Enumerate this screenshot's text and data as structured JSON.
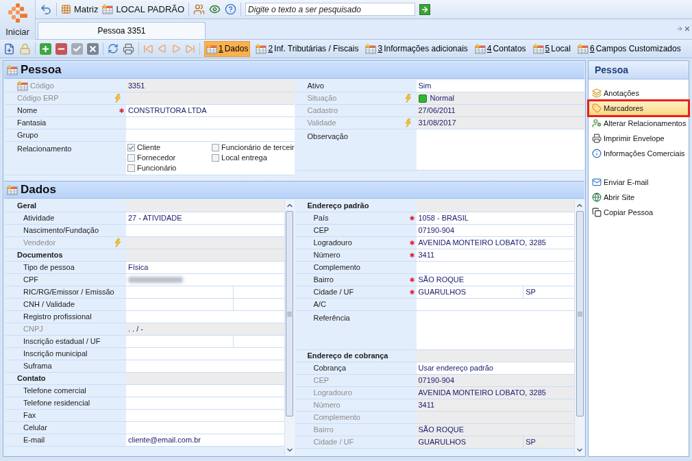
{
  "start_button": {
    "label": "Iniciar"
  },
  "top_toolbar": {
    "items": [
      {
        "label": "Matriz"
      },
      {
        "label": "LOCAL PADRÃO"
      }
    ],
    "search": {
      "placeholder": "Digite o texto a ser pesquisado"
    }
  },
  "document_tabs": [
    {
      "label": "Pessoa 3351",
      "selected": true
    }
  ],
  "record_tabs": [
    {
      "mnemonic": "1",
      "label": "Dados",
      "selected": true
    },
    {
      "mnemonic": "2",
      "label": "Inf. Tributárias / Fiscais",
      "selected": false
    },
    {
      "mnemonic": "3",
      "label": "Informações adicionais",
      "selected": false
    },
    {
      "mnemonic": "4",
      "label": "Contatos",
      "selected": false
    },
    {
      "mnemonic": "5",
      "label": "Local",
      "selected": false
    },
    {
      "mnemonic": "6",
      "label": "Campos Customizados",
      "selected": false
    }
  ],
  "pessoa": {
    "title": "Pessoa",
    "left_rows": [
      {
        "kind": "field",
        "label": "Código",
        "value": "3351",
        "has_icon": true,
        "disabled": true,
        "required": false,
        "lightning": false
      },
      {
        "kind": "field",
        "label": "Código ERP",
        "has_icon": false,
        "disabled": true,
        "required": false,
        "lightning": true
      },
      {
        "kind": "field",
        "label": "Nome",
        "value": "CONSTRUTORA LTDA",
        "has_icon": false,
        "disabled": false,
        "required": true,
        "lightning": false
      },
      {
        "kind": "field",
        "label": "Fantasia",
        "has_icon": false,
        "disabled": false,
        "required": false,
        "lightning": false
      },
      {
        "kind": "field",
        "label": "Grupo",
        "has_icon": false,
        "disabled": false,
        "required": false,
        "lightning": false
      },
      {
        "kind": "checkboxes",
        "label": "Relacionamento",
        "has_icon": false,
        "disabled": false,
        "required": false,
        "lightning": false,
        "options": [
          {
            "label": "Cliente",
            "checked": true
          },
          {
            "label": "Funcionário de terceir",
            "checked": false
          },
          {
            "label": "Fornecedor",
            "checked": false
          },
          {
            "label": "Local entrega",
            "checked": false
          },
          {
            "label": "Funcionário",
            "checked": false
          }
        ]
      }
    ],
    "right_rows": [
      {
        "kind": "field",
        "label": "Ativo",
        "value": "Sim",
        "has_icon": false,
        "disabled": false,
        "required": false,
        "lightning": false
      },
      {
        "kind": "status",
        "label": "Situação",
        "value": "Normal",
        "has_icon": false,
        "disabled": true,
        "required": false,
        "lightning": true
      },
      {
        "kind": "field",
        "label": "Cadastro",
        "value": "27/06/2011",
        "has_icon": false,
        "disabled": true,
        "required": false,
        "lightning": false
      },
      {
        "kind": "field",
        "label": "Validade",
        "value": "31/08/2017",
        "has_icon": false,
        "disabled": true,
        "required": false,
        "lightning": true
      },
      {
        "kind": "memo",
        "label": "Observação",
        "has_icon": false,
        "disabled": false,
        "required": false,
        "lightning": false
      }
    ]
  },
  "dados": {
    "title": "Dados",
    "left_rows": [
      {
        "kind": "header",
        "label": "Geral"
      },
      {
        "kind": "field",
        "label": "Atividade",
        "value": "27 - ATIVIDADE",
        "disabled": false,
        "required": false,
        "lightning": false
      },
      {
        "kind": "field",
        "label": "Nascimento/Fundação",
        "disabled": false,
        "required": false,
        "lightning": false
      },
      {
        "kind": "field",
        "label": "Vendedor",
        "disabled": true,
        "required": false,
        "lightning": true
      },
      {
        "kind": "header",
        "label": "Documentos"
      },
      {
        "kind": "field",
        "label": "Tipo de pessoa",
        "value": "Física",
        "disabled": false,
        "required": false,
        "lightning": false
      },
      {
        "kind": "redacted",
        "label": "CPF",
        "disabled": false,
        "required": false,
        "lightning": false
      },
      {
        "kind": "split",
        "label": "RIC/RG/Emissor / Emissão",
        "disabled": false,
        "required": false,
        "lightning": false
      },
      {
        "kind": "split",
        "label": "CNH / Validade",
        "disabled": false,
        "required": false,
        "lightning": false
      },
      {
        "kind": "field",
        "label": "Registro profissional",
        "disabled": false,
        "required": false,
        "lightning": false
      },
      {
        "kind": "field",
        "label": "CNPJ",
        "value": "  .   .   /    -",
        "disabled": true,
        "required": false,
        "lightning": false
      },
      {
        "kind": "split",
        "label": "Inscrição estadual / UF",
        "disabled": false,
        "required": false,
        "lightning": false
      },
      {
        "kind": "field",
        "label": "Inscrição municipal",
        "disabled": false,
        "required": false,
        "lightning": false
      },
      {
        "kind": "field",
        "label": "Suframa",
        "disabled": false,
        "required": false,
        "lightning": false
      },
      {
        "kind": "header",
        "label": "Contato"
      },
      {
        "kind": "field",
        "label": "Telefone comercial",
        "disabled": false,
        "required": false,
        "lightning": false
      },
      {
        "kind": "field",
        "label": "Telefone residencial",
        "disabled": false,
        "required": false,
        "lightning": false
      },
      {
        "kind": "field",
        "label": "Fax",
        "disabled": false,
        "required": false,
        "lightning": false
      },
      {
        "kind": "field",
        "label": "Celular",
        "disabled": false,
        "required": false,
        "lightning": false
      },
      {
        "kind": "field",
        "label": "E-mail",
        "value": "cliente@email.com.br",
        "disabled": false,
        "required": false,
        "lightning": false
      }
    ],
    "right_rows": [
      {
        "kind": "header",
        "label": "Endereço padrão"
      },
      {
        "kind": "field",
        "label": "País",
        "value": "1058 - BRASIL",
        "disabled": false,
        "required": true,
        "lightning": false
      },
      {
        "kind": "field",
        "label": "CEP",
        "value": "07190-904",
        "disabled": false,
        "required": false,
        "lightning": false
      },
      {
        "kind": "field",
        "label": "Logradouro",
        "value": "AVENIDA MONTEIRO LOBATO, 3285",
        "disabled": false,
        "required": true,
        "lightning": false
      },
      {
        "kind": "field",
        "label": "Número",
        "value": "3411",
        "disabled": false,
        "required": true,
        "lightning": false
      },
      {
        "kind": "field",
        "label": "Complemento",
        "disabled": false,
        "required": false,
        "lightning": false
      },
      {
        "kind": "field",
        "label": "Bairro",
        "value": "SÃO ROQUE",
        "disabled": false,
        "required": true,
        "lightning": false
      },
      {
        "kind": "split",
        "label": "Cidade / UF",
        "value": "GUARULHOS",
        "value_2": "SP",
        "disabled": false,
        "required": true,
        "lightning": false
      },
      {
        "kind": "field",
        "label": "A/C",
        "disabled": false,
        "required": false,
        "lightning": false
      },
      {
        "kind": "memo",
        "label": "Referência",
        "disabled": false,
        "required": false,
        "lightning": false
      },
      {
        "kind": "header",
        "label": "Endereço de cobrança"
      },
      {
        "kind": "field",
        "label": "Cobrança",
        "value": "Usar endereço padrão",
        "disabled": false,
        "required": false,
        "lightning": false
      },
      {
        "kind": "field",
        "label": "CEP",
        "value": "07190-904",
        "disabled": true,
        "required": false,
        "lightning": false
      },
      {
        "kind": "field",
        "label": "Logradouro",
        "value": "AVENIDA MONTEIRO LOBATO, 3285",
        "disabled": true,
        "required": false,
        "lightning": false
      },
      {
        "kind": "field",
        "label": "Número",
        "value": "3411",
        "disabled": true,
        "required": false,
        "lightning": false
      },
      {
        "kind": "field",
        "label": "Complemento",
        "disabled": true,
        "required": false,
        "lightning": false
      },
      {
        "kind": "field",
        "label": "Bairro",
        "value": "SÃO ROQUE",
        "disabled": true,
        "required": false,
        "lightning": false
      },
      {
        "kind": "split",
        "label": "Cidade / UF",
        "value": "GUARULHOS",
        "value_2": "SP",
        "disabled": true,
        "required": false,
        "lightning": false
      }
    ]
  },
  "actions": {
    "title": "Pessoa",
    "groups": [
      {
        "items": [
          {
            "label": "Anotações",
            "selected": false
          },
          {
            "label": "Marcadores",
            "selected": true
          },
          {
            "label": "Alterar Relacionamentos",
            "selected": false
          },
          {
            "label": "Imprimir Envelope",
            "selected": false
          },
          {
            "label": "Informações Comerciais",
            "selected": false
          }
        ]
      },
      {
        "items": [
          {
            "label": "Enviar E-mail",
            "selected": false
          },
          {
            "label": "Abrir Site",
            "selected": false
          },
          {
            "label": "Copiar Pessoa",
            "selected": false
          }
        ]
      }
    ]
  }
}
